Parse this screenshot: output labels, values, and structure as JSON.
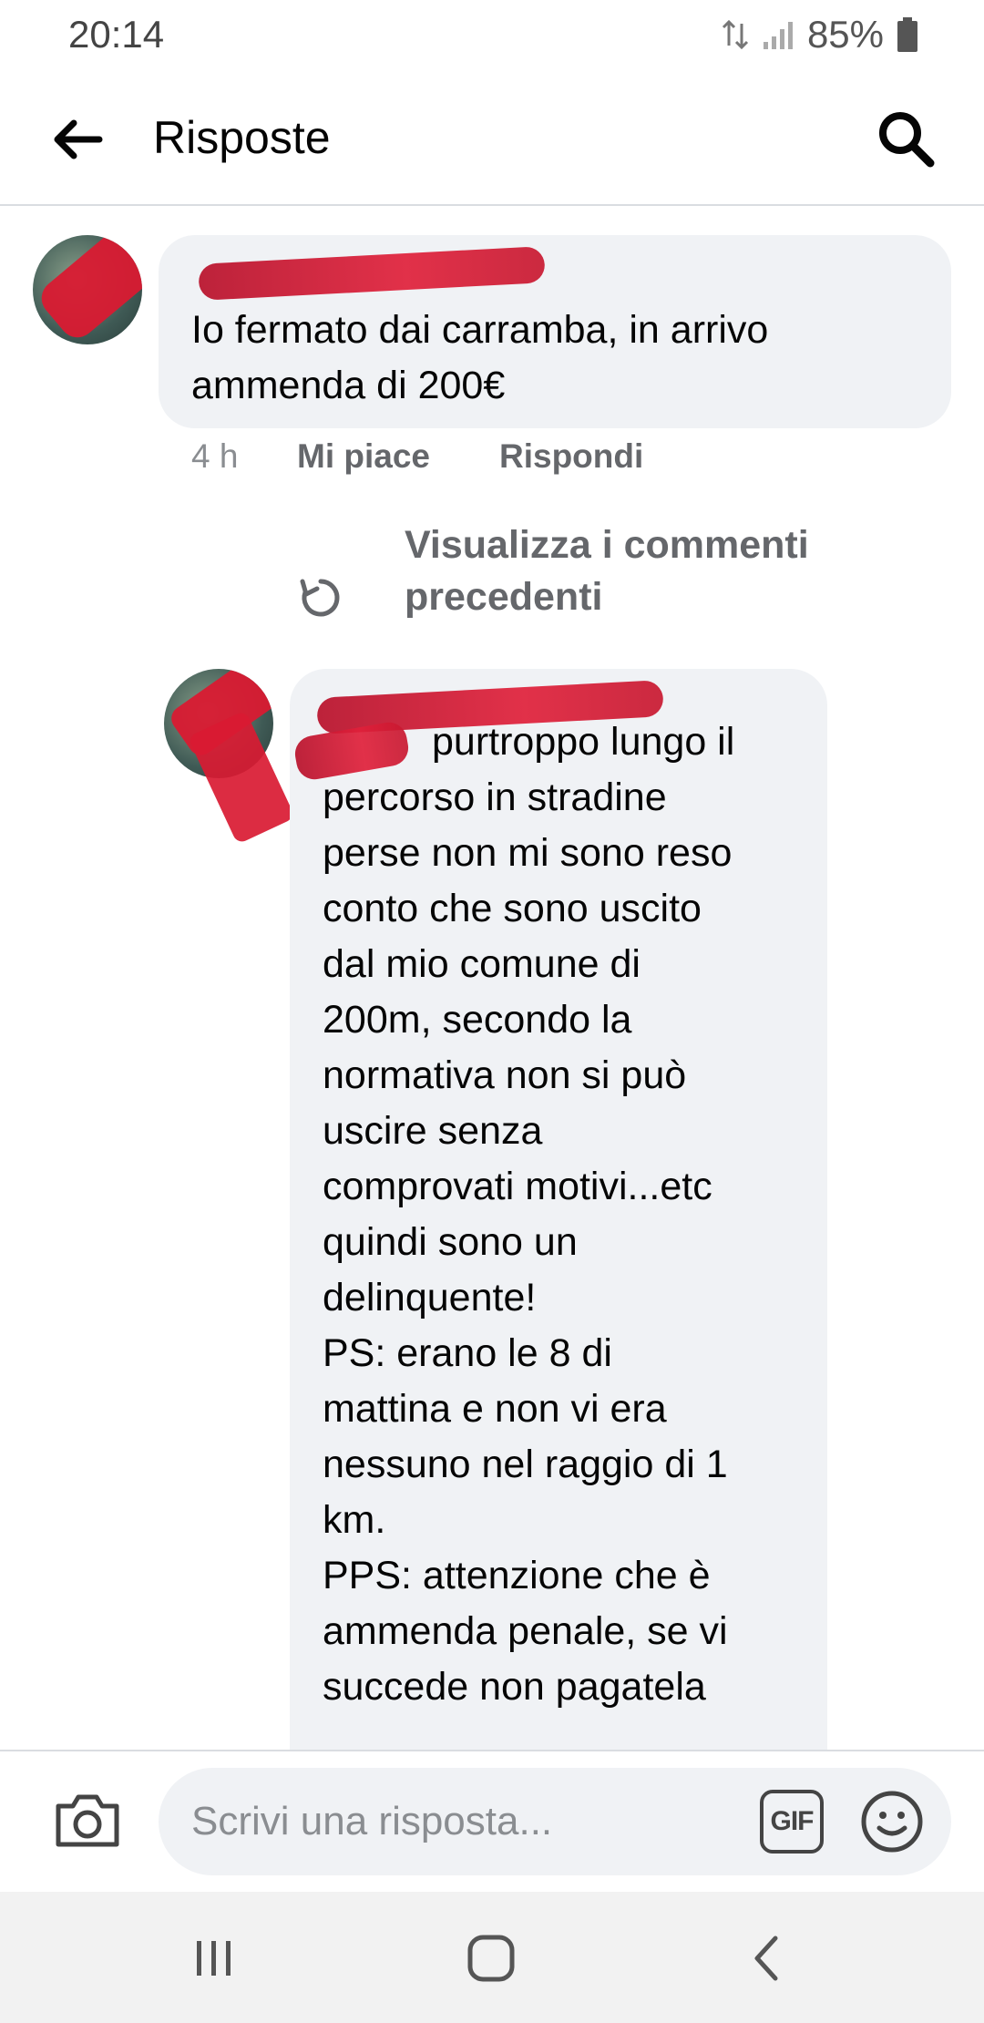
{
  "status_bar": {
    "time": "20:14",
    "battery": "85%"
  },
  "header": {
    "title": "Risposte",
    "back_icon": "arrow-left-icon",
    "search_icon": "search-icon"
  },
  "comments": [
    {
      "text": "Io fermato dai carramba, in arrivo ammenda di 200€",
      "time": "4 h",
      "like_label": "Mi piace",
      "reply_label": "Rispondi"
    },
    {
      "text_lines": [
        "purtroppo lungo il",
        "percorso in stradine",
        "perse non mi sono reso",
        "conto che sono uscito",
        "dal mio comune di",
        "200m, secondo la",
        "normativa non si può",
        "uscire senza",
        "comprovati motivi...etc",
        "quindi sono un",
        "delinquente!",
        "PS: erano le 8 di",
        "mattina e non vi era",
        "nessuno nel raggio di 1",
        "km.",
        "PPS: attenzione che è",
        "ammenda penale, se vi",
        "succede non pagatela"
      ]
    }
  ],
  "previous_comments": {
    "label": "Visualizza i commenti precedenti",
    "icon": "refresh-icon"
  },
  "composer": {
    "placeholder": "Scrivi una risposta...",
    "camera_icon": "camera-icon",
    "gif_label": "GIF",
    "emoji_icon": "smiley-icon"
  },
  "nav": {
    "recents_icon": "recents-icon",
    "home_icon": "home-icon",
    "back_icon": "back-chevron-icon"
  },
  "colors": {
    "bubble": "#f0f2f5",
    "meta": "#65676b",
    "redaction": "#d91a32"
  }
}
